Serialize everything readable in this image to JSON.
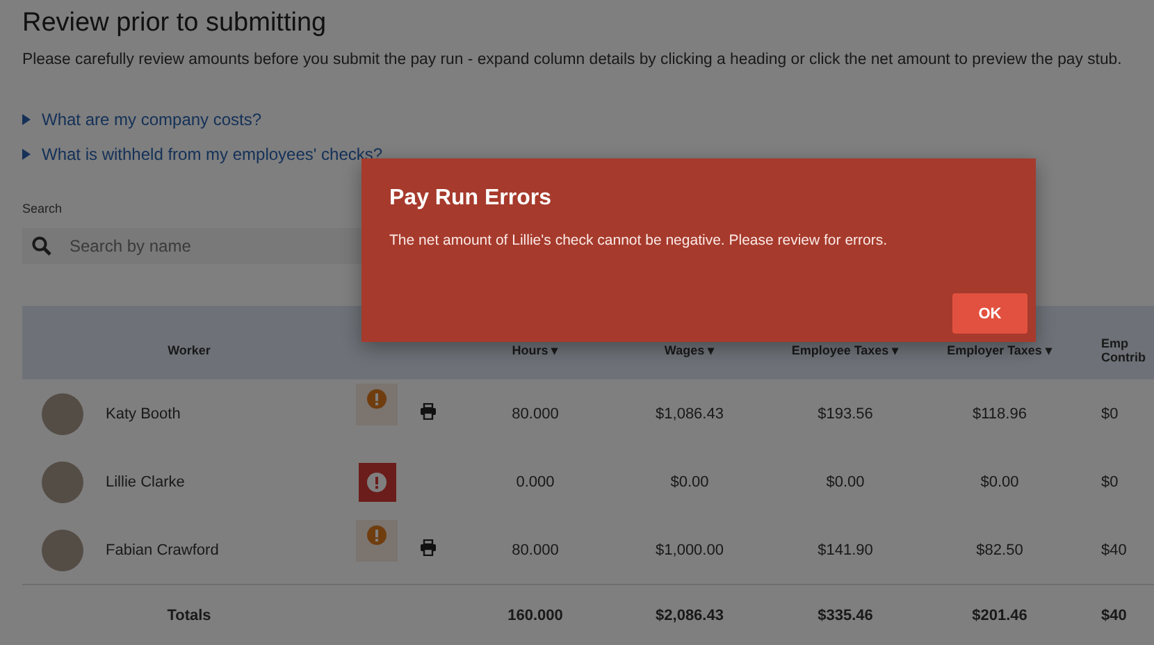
{
  "page": {
    "title": "Review prior to submitting",
    "description": "Please carefully review amounts before you submit the pay run - expand column details by clicking a heading or click the net amount to preview the pay stub.",
    "links": [
      {
        "label": "What are my company costs?",
        "expanded": false
      },
      {
        "label": "What is withheld from my employees' checks?",
        "expanded": false
      }
    ]
  },
  "search": {
    "label": "Search",
    "placeholder": "Search by name"
  },
  "table": {
    "columns": [
      "Worker",
      "Hours ▾",
      "Wages ▾",
      "Employee Taxes ▾",
      "Employer Taxes ▾",
      "Emp\nContrib"
    ],
    "rows": [
      {
        "kind": "warning",
        "printable": true,
        "cells": [
          "Katy Booth",
          "80.000",
          "$1,086.43",
          "$193.56",
          "$118.96",
          "$0"
        ]
      },
      {
        "kind": "error",
        "printable": false,
        "cells": [
          "Lillie Clarke",
          "0.000",
          "$0.00",
          "$0.00",
          "$0.00",
          "$0"
        ]
      },
      {
        "kind": "warning",
        "printable": true,
        "cells": [
          "Fabian Crawford",
          "80.000",
          "$1,000.00",
          "$141.90",
          "$82.50",
          "$40"
        ]
      }
    ],
    "totals": {
      "cells": [
        "Totals",
        "160.000",
        "$2,086.43",
        "$335.46",
        "$201.46",
        "$40"
      ]
    }
  },
  "dialog": {
    "title": "Pay Run Errors",
    "message": "The net amount of Lillie's check cannot be negative. Please review for errors.",
    "button": "OK"
  }
}
